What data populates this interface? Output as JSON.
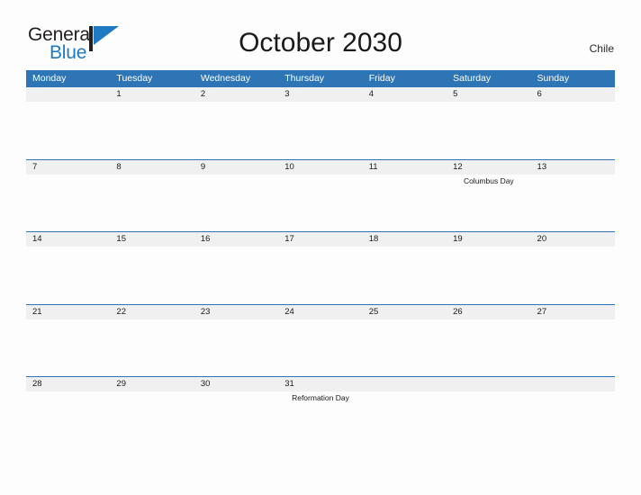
{
  "brand": {
    "name_part1": "General",
    "name_part2": "Blue",
    "flag_icon": "blue-flag-icon",
    "accent_color": "#1f7ac4"
  },
  "header": {
    "title": "October 2030",
    "country": "Chile"
  },
  "colors": {
    "header_blue": "#2e75b6",
    "date_band_gray": "#f0f0f0",
    "page_background": "#fdfdfd",
    "text": "#1a1a1a"
  },
  "calendar": {
    "month": "October",
    "year": "2030",
    "weekdays": [
      "Monday",
      "Tuesday",
      "Wednesday",
      "Thursday",
      "Friday",
      "Saturday",
      "Sunday"
    ],
    "weeks": [
      {
        "days": [
          {
            "date": "",
            "event": ""
          },
          {
            "date": "1",
            "event": ""
          },
          {
            "date": "2",
            "event": ""
          },
          {
            "date": "3",
            "event": ""
          },
          {
            "date": "4",
            "event": ""
          },
          {
            "date": "5",
            "event": ""
          },
          {
            "date": "6",
            "event": ""
          }
        ]
      },
      {
        "days": [
          {
            "date": "7",
            "event": ""
          },
          {
            "date": "8",
            "event": ""
          },
          {
            "date": "9",
            "event": ""
          },
          {
            "date": "10",
            "event": ""
          },
          {
            "date": "11",
            "event": ""
          },
          {
            "date": "12",
            "event": "Columbus Day"
          },
          {
            "date": "13",
            "event": ""
          }
        ]
      },
      {
        "days": [
          {
            "date": "14",
            "event": ""
          },
          {
            "date": "15",
            "event": ""
          },
          {
            "date": "16",
            "event": ""
          },
          {
            "date": "17",
            "event": ""
          },
          {
            "date": "18",
            "event": ""
          },
          {
            "date": "19",
            "event": ""
          },
          {
            "date": "20",
            "event": ""
          }
        ]
      },
      {
        "days": [
          {
            "date": "21",
            "event": ""
          },
          {
            "date": "22",
            "event": ""
          },
          {
            "date": "23",
            "event": ""
          },
          {
            "date": "24",
            "event": ""
          },
          {
            "date": "25",
            "event": ""
          },
          {
            "date": "26",
            "event": ""
          },
          {
            "date": "27",
            "event": ""
          }
        ]
      },
      {
        "days": [
          {
            "date": "28",
            "event": ""
          },
          {
            "date": "29",
            "event": ""
          },
          {
            "date": "30",
            "event": ""
          },
          {
            "date": "31",
            "event": "Reformation Day"
          },
          {
            "date": "",
            "event": ""
          },
          {
            "date": "",
            "event": ""
          },
          {
            "date": "",
            "event": ""
          }
        ]
      }
    ]
  }
}
